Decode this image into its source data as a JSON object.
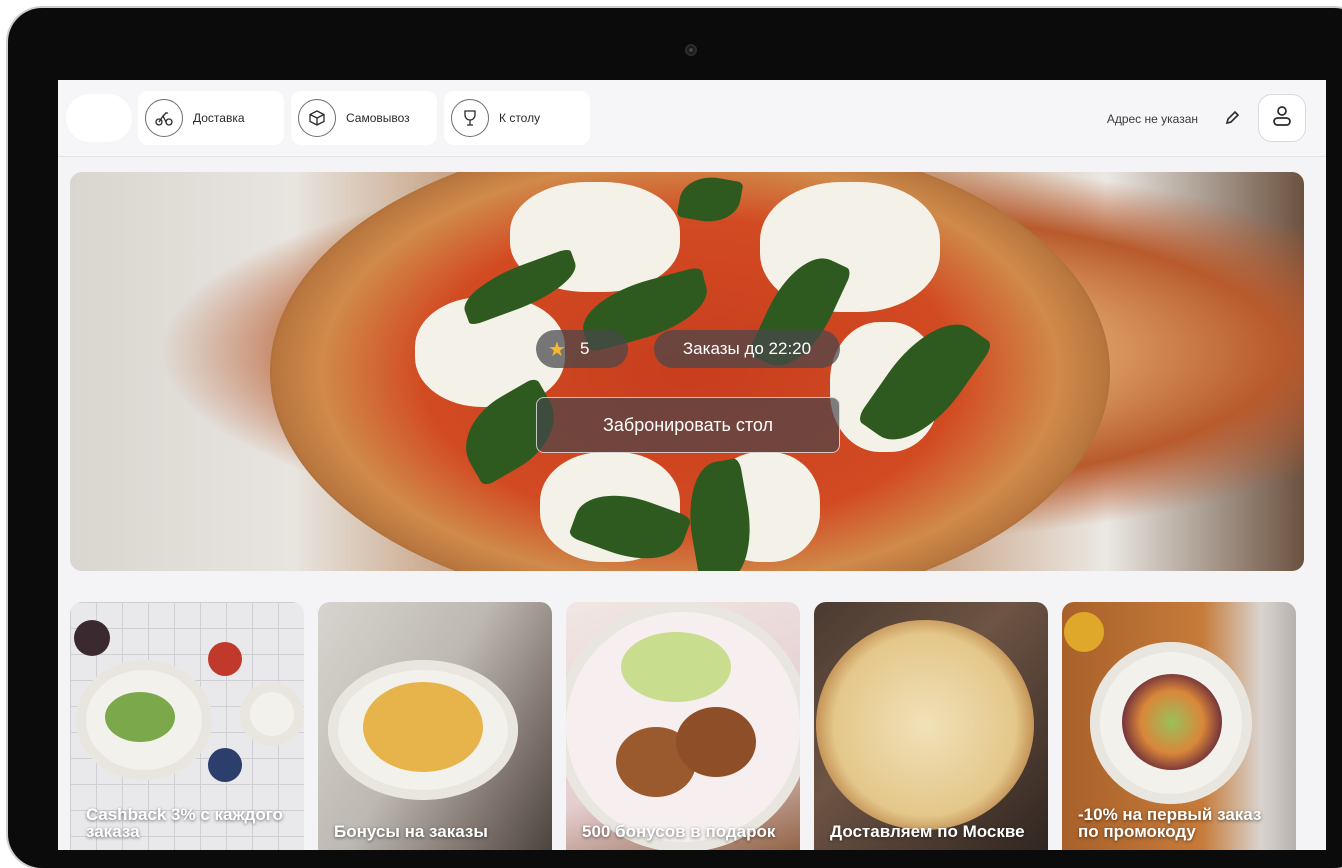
{
  "header": {
    "tabs": [
      {
        "label": "Доставка",
        "icon": "bike-icon"
      },
      {
        "label": "Самовывоз",
        "icon": "box-icon"
      },
      {
        "label": "К столу",
        "icon": "wine-glass-icon"
      }
    ],
    "address": "Адрес не указан",
    "edit_icon": "pencil-icon",
    "profile_icon": "user-icon"
  },
  "hero": {
    "rating": "5",
    "hours": "Заказы до 22:20",
    "book_button": "Забронировать стол"
  },
  "promos": [
    {
      "title": "Cashback 3% с каждого заказа"
    },
    {
      "title": "Бонусы на заказы"
    },
    {
      "title": "500 бонусов в подарок"
    },
    {
      "title": "Доставляем по Москве"
    },
    {
      "title": "-10% на первый заказ по промокоду"
    }
  ],
  "colors": {
    "star": "#f5b82e",
    "badge_bg": "#46464b",
    "screen_bg": "#f4f4f6"
  }
}
